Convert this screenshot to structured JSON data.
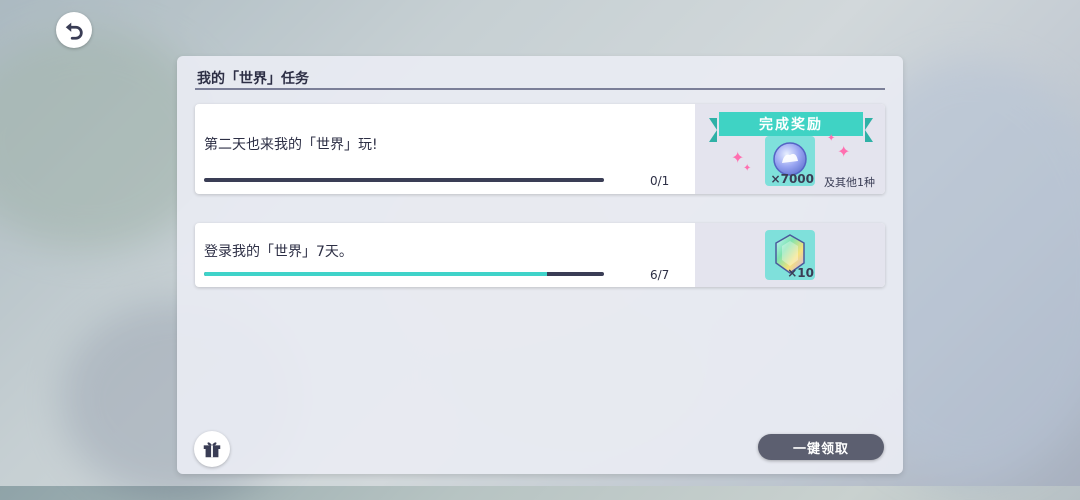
{
  "panel": {
    "title": "我的「世界」任务"
  },
  "tasks": [
    {
      "text": "第二天也来我的「世界」玩!",
      "progress": {
        "current": 0,
        "total": 1,
        "label": "0/1",
        "fraction": 0.0
      },
      "reward": {
        "banner": "完成奖励",
        "item_icon": "coin-icon",
        "quantity": "×7000",
        "extra": "及其他1种"
      }
    },
    {
      "text": "登录我的「世界」7天。",
      "progress": {
        "current": 6,
        "total": 7,
        "label": "6/7",
        "fraction": 0.857
      },
      "reward": {
        "item_icon": "crystal-icon",
        "quantity": "×10"
      }
    }
  ],
  "footer": {
    "claim_all_label": "一键领取"
  },
  "icons": {
    "back": "back-arrow-icon",
    "gift": "gift-icon"
  },
  "colors": {
    "accent": "#3fd3c4",
    "progress_track": "#3a3d55",
    "text": "#2d2f45",
    "sparkle": "#ff6fb0"
  }
}
